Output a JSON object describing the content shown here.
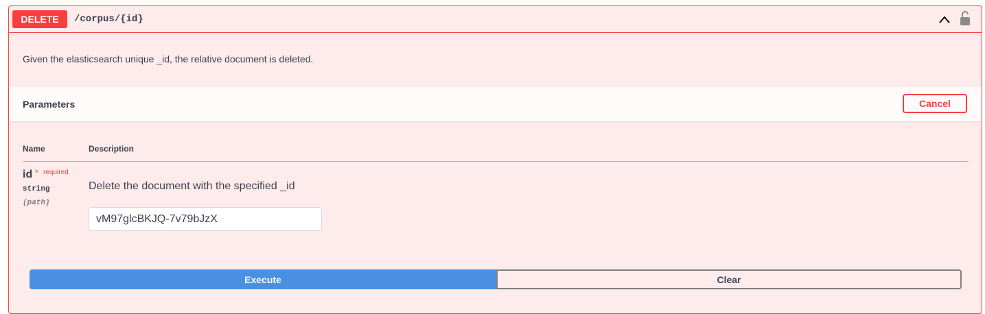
{
  "operation": {
    "method": "DELETE",
    "path": "/corpus/{id}",
    "description": "Given the elasticsearch unique _id, the relative document is deleted.",
    "method_color": "#f93e3e"
  },
  "parameters": {
    "title": "Parameters",
    "cancel_label": "Cancel",
    "columns": {
      "name": "Name",
      "description": "Description"
    },
    "items": [
      {
        "name": "id",
        "required_star": "*",
        "required_label": "required",
        "type": "string",
        "in": "(path)",
        "description": "Delete the document with the specified _id",
        "value": "vM97glcBKJQ-7v79bJzX"
      }
    ]
  },
  "actions": {
    "execute_label": "Execute",
    "clear_label": "Clear",
    "execute_color": "#4990e2"
  },
  "icons": {
    "collapse": "chevron-up-icon",
    "auth": "unlocked-padlock-icon"
  }
}
